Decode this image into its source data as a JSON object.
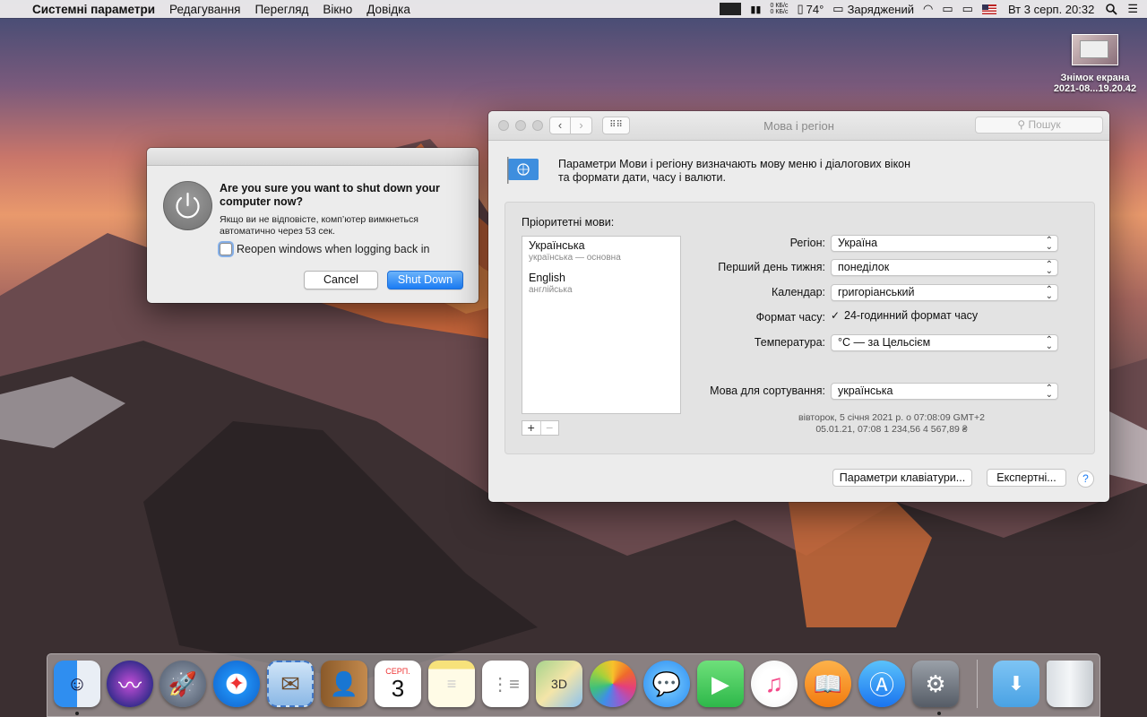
{
  "menubar": {
    "apple": "",
    "app_name": "Системні параметри",
    "menus": [
      "Редагування",
      "Перегляд",
      "Вікно",
      "Довідка"
    ],
    "net_up": "0 КБ/с",
    "net_down": "0 КБ/с",
    "temperature": "74°",
    "battery_status": "Заряджений",
    "datetime": "Вт 3 серп.  20:32"
  },
  "desktop": {
    "screenshot_label_1": "Знімок екрана",
    "screenshot_label_2": "2021-08...19.20.42"
  },
  "shutdown_dialog": {
    "title": "Are you sure you want to shut down your computer now?",
    "message": "Якщо ви не відповісте, комп’ютер вимкнеться автоматично через 53 сек.",
    "checkbox_label": "Reopen windows when logging back in",
    "checkbox_checked": false,
    "cancel_label": "Cancel",
    "confirm_label": "Shut Down"
  },
  "prefs": {
    "window_title": "Мова і регіон",
    "search_placeholder": "Пошук",
    "description_line1": "Параметри Мови і регіону визначають мову меню і діалогових вікон",
    "description_line2": "та формати дати, часу і валюти.",
    "preferred_languages_label": "Пріоритетні мови:",
    "languages": [
      {
        "name": "Українська",
        "sub": "українська — основна"
      },
      {
        "name": "English",
        "sub": "англійська"
      }
    ],
    "add_label": "+",
    "remove_label": "−",
    "region_label": "Регіон:",
    "region_value": "Україна",
    "first_day_label": "Перший день тижня:",
    "first_day_value": "понеділок",
    "calendar_label": "Календар:",
    "calendar_value": "григоріанський",
    "time_format_label": "Формат часу:",
    "time_format_value": "24-годинний формат часу",
    "time_format_checked": true,
    "temperature_label": "Температура:",
    "temperature_value": "°C — за Цельсієм",
    "sort_label": "Мова для сортування:",
    "sort_value": "українська",
    "sample_line1": "вівторок, 5 січня 2021 р. о 07:08:09 GMT+2",
    "sample_line2": "05.01.21, 07:08     1 234,56     4 567,89 ₴",
    "keyboard_button": "Параметри клавіатури...",
    "advanced_button": "Експертні...",
    "help_label": "?"
  },
  "dock": {
    "apps": [
      "finder-icon",
      "siri-icon",
      "launchpad-icon",
      "safari-icon",
      "mail-icon",
      "contacts-icon",
      "calendar-icon",
      "notes-icon",
      "reminders-icon",
      "maps-icon",
      "photos-icon",
      "messages-icon",
      "facetime-icon",
      "itunes-icon",
      "ibooks-icon",
      "app-store-icon",
      "system-preferences-icon",
      "downloads-folder-icon",
      "trash-icon"
    ],
    "calendar_month": "СЕРП.",
    "calendar_day": "3"
  },
  "colors": {
    "accent": "#1b7cf4",
    "window_bg": "#ececec"
  }
}
